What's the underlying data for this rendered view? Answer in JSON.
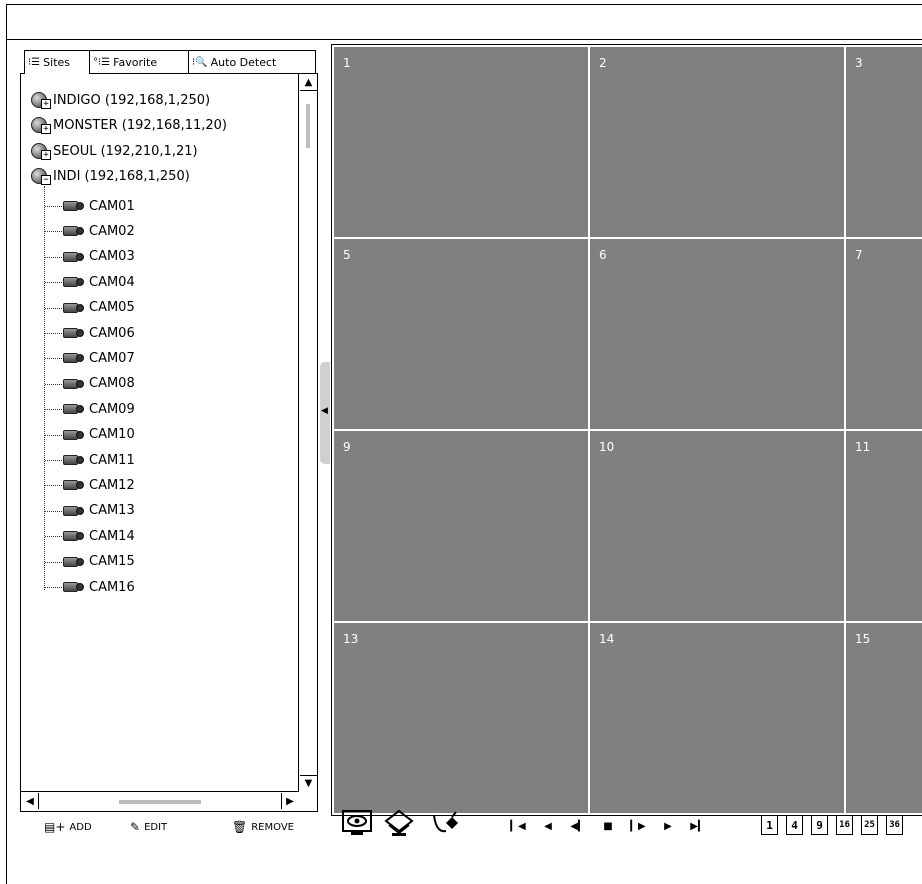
{
  "tabs": [
    {
      "label": "Sites",
      "icon": "list-icon"
    },
    {
      "label": "Favorite",
      "icon": "favorite-list-icon"
    },
    {
      "label": "Auto Detect",
      "icon": "auto-detect-icon"
    }
  ],
  "tree": {
    "sites": [
      {
        "label": "INDIGO (192,168,1,250)",
        "expanded": false
      },
      {
        "label": "MONSTER (192,168,11,20)",
        "expanded": false
      },
      {
        "label": "SEOUL (192,210,1,21)",
        "expanded": false
      },
      {
        "label": "INDI (192,168,1,250)",
        "expanded": true
      }
    ],
    "cameras": [
      "CAM01",
      "CAM02",
      "CAM03",
      "CAM04",
      "CAM05",
      "CAM06",
      "CAM07",
      "CAM08",
      "CAM09",
      "CAM10",
      "CAM11",
      "CAM12",
      "CAM13",
      "CAM14",
      "CAM15",
      "CAM16"
    ]
  },
  "grid": {
    "cells": [
      "1",
      "2",
      "3",
      "5",
      "6",
      "7",
      "9",
      "10",
      "11",
      "13",
      "14",
      "15"
    ],
    "cell_color": "#808080"
  },
  "actions": {
    "add": "ADD",
    "edit": "EDIT",
    "remove": "REMOVE"
  },
  "view_icons": [
    "monitor-eye-icon",
    "layers-icon",
    "plug-icon"
  ],
  "playback": [
    "first-icon",
    "prev-icon",
    "step-back-icon",
    "stop-icon",
    "step-forward-icon",
    "play-icon",
    "last-icon"
  ],
  "splits": [
    "1",
    "4",
    "9",
    "16",
    "25",
    "36"
  ]
}
